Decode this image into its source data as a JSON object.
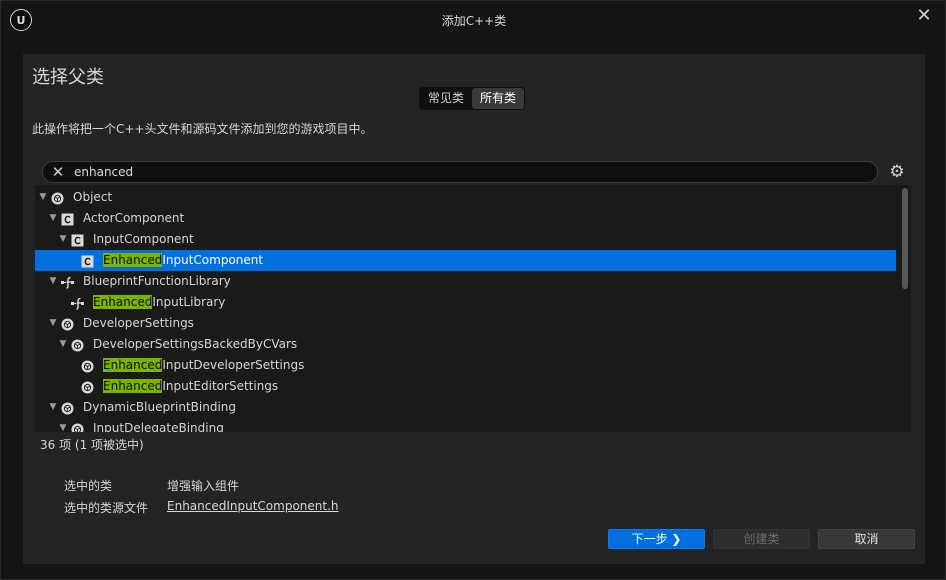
{
  "window": {
    "title": "添加C++类",
    "logo_text": "U",
    "close_glyph": "✕"
  },
  "page": {
    "heading": "选择父类",
    "description": "此操作将把一个C++头文件和源码文件添加到您的游戏项目中。"
  },
  "filter_tabs": [
    {
      "label": "常见类",
      "active": false
    },
    {
      "label": "所有类",
      "active": true
    }
  ],
  "search": {
    "value": "enhanced",
    "placeholder": "",
    "clear_glyph": "✕"
  },
  "settings_glyph": "⚙",
  "tree": {
    "rows": [
      {
        "label": "Object",
        "highlight": "",
        "icon": "object-icon",
        "expanded": true,
        "selected": false
      },
      {
        "label": "ActorComponent",
        "highlight": "",
        "icon": "class-icon",
        "expanded": true,
        "selected": false
      },
      {
        "label": "InputComponent",
        "highlight": "",
        "icon": "class-icon",
        "expanded": true,
        "selected": false
      },
      {
        "label": "InputComponent",
        "highlight": "Enhanced",
        "icon": "class-icon",
        "expanded": null,
        "selected": true
      },
      {
        "label": "BlueprintFunctionLibrary",
        "highlight": "",
        "icon": "function-library-icon",
        "expanded": true,
        "selected": false
      },
      {
        "label": "InputLibrary",
        "highlight": "Enhanced",
        "icon": "function-library-icon",
        "expanded": null,
        "selected": false
      },
      {
        "label": "DeveloperSettings",
        "highlight": "",
        "icon": "object-icon",
        "expanded": true,
        "selected": false
      },
      {
        "label": "DeveloperSettingsBackedByCVars",
        "highlight": "",
        "icon": "object-icon",
        "expanded": true,
        "selected": false
      },
      {
        "label": "InputDeveloperSettings",
        "highlight": "Enhanced",
        "icon": "object-icon",
        "expanded": null,
        "selected": false
      },
      {
        "label": "InputEditorSettings",
        "highlight": "Enhanced",
        "icon": "object-icon",
        "expanded": null,
        "selected": false
      },
      {
        "label": "DynamicBlueprintBinding",
        "highlight": "",
        "icon": "object-icon",
        "expanded": true,
        "selected": false
      },
      {
        "label": "InputDelegateBinding",
        "highlight": "",
        "icon": "object-icon",
        "expanded": true,
        "selected": false
      }
    ]
  },
  "status": {
    "count_text": "36 项 (1 项被选中)"
  },
  "selection_info": {
    "class_label": "选中的类",
    "class_value": "增强输入组件",
    "file_label": "选中的类源文件",
    "file_value": "EnhancedInputComponent.h"
  },
  "buttons": {
    "next": "下一步 ❯",
    "create": "创建类",
    "cancel": "取消"
  },
  "colors": {
    "accent": "#0070e0",
    "highlight": "#7cb500",
    "panel": "#242424",
    "tree_background": "#1a1a1a",
    "window_background": "#151515"
  }
}
